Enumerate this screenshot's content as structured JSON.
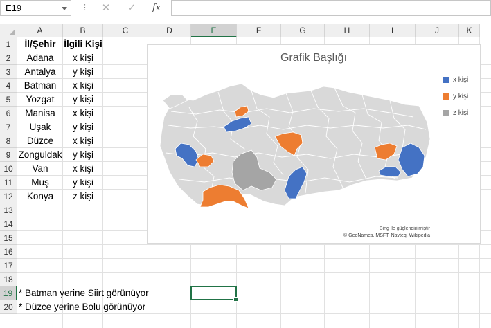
{
  "formula_bar": {
    "name_box": "E19",
    "cancel_icon": "✕",
    "enter_icon": "✓",
    "fx_label": "fx",
    "content": ""
  },
  "columns": [
    "A",
    "B",
    "C",
    "D",
    "E",
    "F",
    "G",
    "H",
    "I",
    "J",
    "K"
  ],
  "rows": [
    "1",
    "2",
    "3",
    "4",
    "5",
    "6",
    "7",
    "8",
    "9",
    "10",
    "11",
    "12",
    "13",
    "14",
    "15",
    "16",
    "17",
    "18",
    "19",
    "20"
  ],
  "selected": {
    "column": "E",
    "row": "19"
  },
  "table": {
    "headers": [
      "İl/Şehir",
      "İlgili Kişi"
    ],
    "rows": [
      [
        "Adana",
        "x kişi"
      ],
      [
        "Antalya",
        "y kişi"
      ],
      [
        "Batman",
        "x kişi"
      ],
      [
        "Yozgat",
        "y kişi"
      ],
      [
        "Manisa",
        "x kişi"
      ],
      [
        "Uşak",
        "y kişi"
      ],
      [
        "Düzce",
        "x kişi"
      ],
      [
        "Zonguldak",
        "y kişi"
      ],
      [
        "Van",
        "x kişi"
      ],
      [
        "Muş",
        "y kişi"
      ],
      [
        "Konya",
        "z kişi"
      ]
    ]
  },
  "notes": [
    "* Batman yerine Siirt görünüyor",
    "* Düzce yerine Bolu görünüyor"
  ],
  "chart_data": {
    "type": "map",
    "title": "Grafik Başlığı",
    "legend": [
      {
        "label": "x kişi",
        "color": "#4472c4"
      },
      {
        "label": "y kişi",
        "color": "#ed7d31"
      },
      {
        "label": "z kişi",
        "color": "#a5a5a5"
      }
    ],
    "legend_position": "right",
    "base_color": "#d9d9d9",
    "attribution": [
      "Bing ile güçlendirilmiştir",
      "© GeoNames, MSFT, Navteq, Wikipedia"
    ]
  },
  "colors": {
    "accent": "#217346",
    "grid": "#e1e1e1",
    "header_bg": "#efefef"
  }
}
